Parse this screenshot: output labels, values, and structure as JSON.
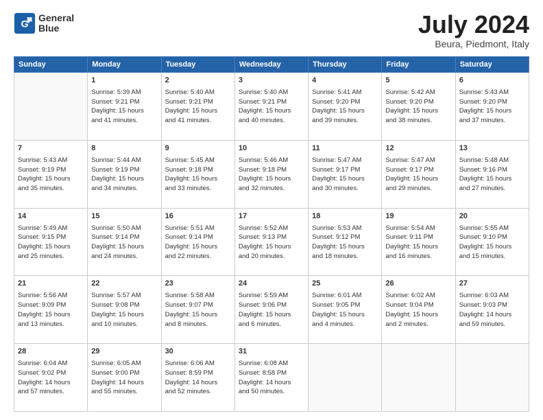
{
  "header": {
    "logo_line1": "General",
    "logo_line2": "Blue",
    "title": "July 2024",
    "subtitle": "Beura, Piedmont, Italy"
  },
  "days_of_week": [
    "Sunday",
    "Monday",
    "Tuesday",
    "Wednesday",
    "Thursday",
    "Friday",
    "Saturday"
  ],
  "weeks": [
    [
      {
        "day": "",
        "info": ""
      },
      {
        "day": "1",
        "info": "Sunrise: 5:39 AM\nSunset: 9:21 PM\nDaylight: 15 hours\nand 41 minutes."
      },
      {
        "day": "2",
        "info": "Sunrise: 5:40 AM\nSunset: 9:21 PM\nDaylight: 15 hours\nand 41 minutes."
      },
      {
        "day": "3",
        "info": "Sunrise: 5:40 AM\nSunset: 9:21 PM\nDaylight: 15 hours\nand 40 minutes."
      },
      {
        "day": "4",
        "info": "Sunrise: 5:41 AM\nSunset: 9:20 PM\nDaylight: 15 hours\nand 39 minutes."
      },
      {
        "day": "5",
        "info": "Sunrise: 5:42 AM\nSunset: 9:20 PM\nDaylight: 15 hours\nand 38 minutes."
      },
      {
        "day": "6",
        "info": "Sunrise: 5:43 AM\nSunset: 9:20 PM\nDaylight: 15 hours\nand 37 minutes."
      }
    ],
    [
      {
        "day": "7",
        "info": "Sunrise: 5:43 AM\nSunset: 9:19 PM\nDaylight: 15 hours\nand 35 minutes."
      },
      {
        "day": "8",
        "info": "Sunrise: 5:44 AM\nSunset: 9:19 PM\nDaylight: 15 hours\nand 34 minutes."
      },
      {
        "day": "9",
        "info": "Sunrise: 5:45 AM\nSunset: 9:18 PM\nDaylight: 15 hours\nand 33 minutes."
      },
      {
        "day": "10",
        "info": "Sunrise: 5:46 AM\nSunset: 9:18 PM\nDaylight: 15 hours\nand 32 minutes."
      },
      {
        "day": "11",
        "info": "Sunrise: 5:47 AM\nSunset: 9:17 PM\nDaylight: 15 hours\nand 30 minutes."
      },
      {
        "day": "12",
        "info": "Sunrise: 5:47 AM\nSunset: 9:17 PM\nDaylight: 15 hours\nand 29 minutes."
      },
      {
        "day": "13",
        "info": "Sunrise: 5:48 AM\nSunset: 9:16 PM\nDaylight: 15 hours\nand 27 minutes."
      }
    ],
    [
      {
        "day": "14",
        "info": "Sunrise: 5:49 AM\nSunset: 9:15 PM\nDaylight: 15 hours\nand 25 minutes."
      },
      {
        "day": "15",
        "info": "Sunrise: 5:50 AM\nSunset: 9:14 PM\nDaylight: 15 hours\nand 24 minutes."
      },
      {
        "day": "16",
        "info": "Sunrise: 5:51 AM\nSunset: 9:14 PM\nDaylight: 15 hours\nand 22 minutes."
      },
      {
        "day": "17",
        "info": "Sunrise: 5:52 AM\nSunset: 9:13 PM\nDaylight: 15 hours\nand 20 minutes."
      },
      {
        "day": "18",
        "info": "Sunrise: 5:53 AM\nSunset: 9:12 PM\nDaylight: 15 hours\nand 18 minutes."
      },
      {
        "day": "19",
        "info": "Sunrise: 5:54 AM\nSunset: 9:11 PM\nDaylight: 15 hours\nand 16 minutes."
      },
      {
        "day": "20",
        "info": "Sunrise: 5:55 AM\nSunset: 9:10 PM\nDaylight: 15 hours\nand 15 minutes."
      }
    ],
    [
      {
        "day": "21",
        "info": "Sunrise: 5:56 AM\nSunset: 9:09 PM\nDaylight: 15 hours\nand 13 minutes."
      },
      {
        "day": "22",
        "info": "Sunrise: 5:57 AM\nSunset: 9:08 PM\nDaylight: 15 hours\nand 10 minutes."
      },
      {
        "day": "23",
        "info": "Sunrise: 5:58 AM\nSunset: 9:07 PM\nDaylight: 15 hours\nand 8 minutes."
      },
      {
        "day": "24",
        "info": "Sunrise: 5:59 AM\nSunset: 9:06 PM\nDaylight: 15 hours\nand 6 minutes."
      },
      {
        "day": "25",
        "info": "Sunrise: 6:01 AM\nSunset: 9:05 PM\nDaylight: 15 hours\nand 4 minutes."
      },
      {
        "day": "26",
        "info": "Sunrise: 6:02 AM\nSunset: 9:04 PM\nDaylight: 15 hours\nand 2 minutes."
      },
      {
        "day": "27",
        "info": "Sunrise: 6:03 AM\nSunset: 9:03 PM\nDaylight: 14 hours\nand 59 minutes."
      }
    ],
    [
      {
        "day": "28",
        "info": "Sunrise: 6:04 AM\nSunset: 9:02 PM\nDaylight: 14 hours\nand 57 minutes."
      },
      {
        "day": "29",
        "info": "Sunrise: 6:05 AM\nSunset: 9:00 PM\nDaylight: 14 hours\nand 55 minutes."
      },
      {
        "day": "30",
        "info": "Sunrise: 6:06 AM\nSunset: 8:59 PM\nDaylight: 14 hours\nand 52 minutes."
      },
      {
        "day": "31",
        "info": "Sunrise: 6:08 AM\nSunset: 8:58 PM\nDaylight: 14 hours\nand 50 minutes."
      },
      {
        "day": "",
        "info": ""
      },
      {
        "day": "",
        "info": ""
      },
      {
        "day": "",
        "info": ""
      }
    ]
  ]
}
